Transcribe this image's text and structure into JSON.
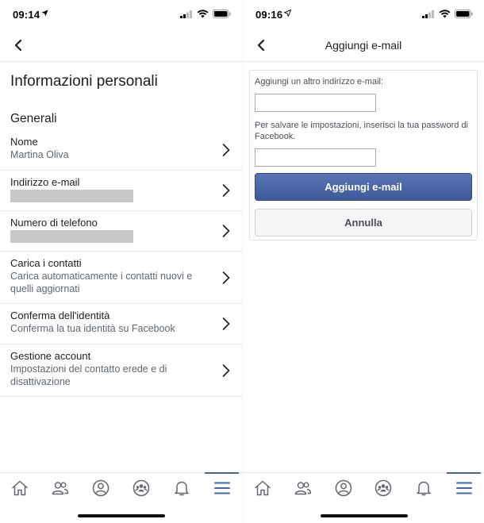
{
  "left": {
    "status": {
      "time": "09:14"
    },
    "page_title": "Informazioni personali",
    "section_title": "Generali",
    "items": [
      {
        "title": "Nome",
        "subtitle": "Martina Oliva"
      },
      {
        "title": "Indirizzo e-mail"
      },
      {
        "title": "Numero di telefono"
      },
      {
        "title": "Carica i contatti",
        "subtitle": "Carica automaticamente i contatti nuovi e quelli aggiornati"
      },
      {
        "title": "Conferma dell'identità",
        "subtitle": "Conferma la tua identità su Facebook"
      },
      {
        "title": "Gestione account",
        "subtitle": "Impostazioni del contatto erede e di disattivazione"
      }
    ]
  },
  "right": {
    "status": {
      "time": "09:16"
    },
    "header_title": "Aggiungi e-mail",
    "form": {
      "email_label": "Aggiungi un altro indirizzo e-mail:",
      "email_value": "",
      "password_label": "Per salvare le impostazioni, inserisci la tua password di Facebook.",
      "password_value": "",
      "submit_label": "Aggiungi e-mail",
      "cancel_label": "Annulla"
    }
  },
  "tabs": [
    {
      "icon": "home-icon"
    },
    {
      "icon": "friends-icon"
    },
    {
      "icon": "profile-icon"
    },
    {
      "icon": "groups-icon"
    },
    {
      "icon": "notifications-icon"
    },
    {
      "icon": "menu-icon",
      "active": true
    }
  ],
  "colors": {
    "accent": "#4267b2",
    "primary_button": "#3b5998",
    "secondary_button": "#f5f6f7",
    "text": "#1c1e21",
    "subtext": "#606770",
    "redacted": "#c8c8c8"
  }
}
